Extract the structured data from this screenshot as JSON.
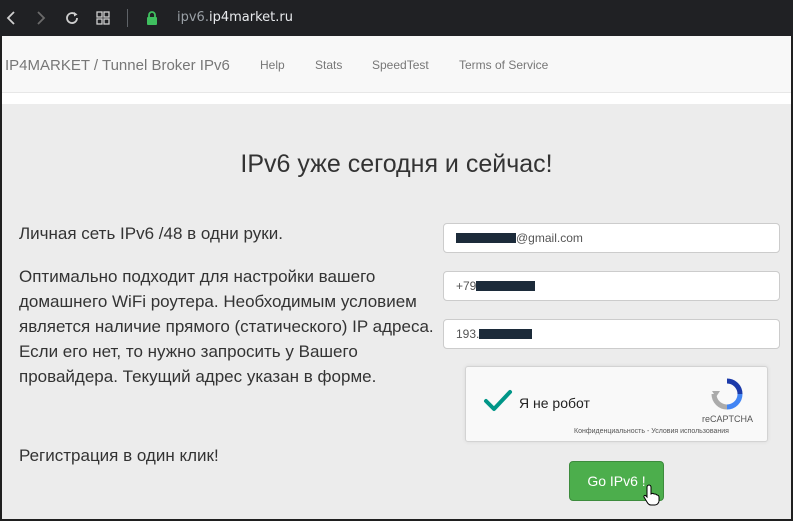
{
  "browser": {
    "url_prefix": "ipv6.",
    "url_host": "ip4market.ru"
  },
  "navbar": {
    "brand": "IP4MARKET / Tunnel Broker IPv6",
    "links": [
      "Help",
      "Stats",
      "SpeedTest",
      "Terms of Service"
    ]
  },
  "main": {
    "headline": "IPv6 уже сегодня и сейчас!",
    "lead": "Личная сеть IPv6 /48 в одни руки.",
    "description": "Оптимально подходит для настройки вашего домашнего WiFi роутера. Необходимым условием является наличие прямого (статического) IP адреса. Если его нет, то нужно запросить у Вашего провайдера. Текущий адрес указан в форме.",
    "registration": "Регистрация в один клик!"
  },
  "form": {
    "email_suffix": "@gmail.com",
    "phone_prefix": "+79",
    "ip_prefix": "193.",
    "captcha_label": "Я не робот",
    "captcha_brand": "reCAPTCHA",
    "captcha_legal": "Конфиденциальность - Условия использования",
    "submit_label": "Go IPv6 !"
  },
  "colors": {
    "submit": "#4cae4c",
    "check": "#009688"
  }
}
